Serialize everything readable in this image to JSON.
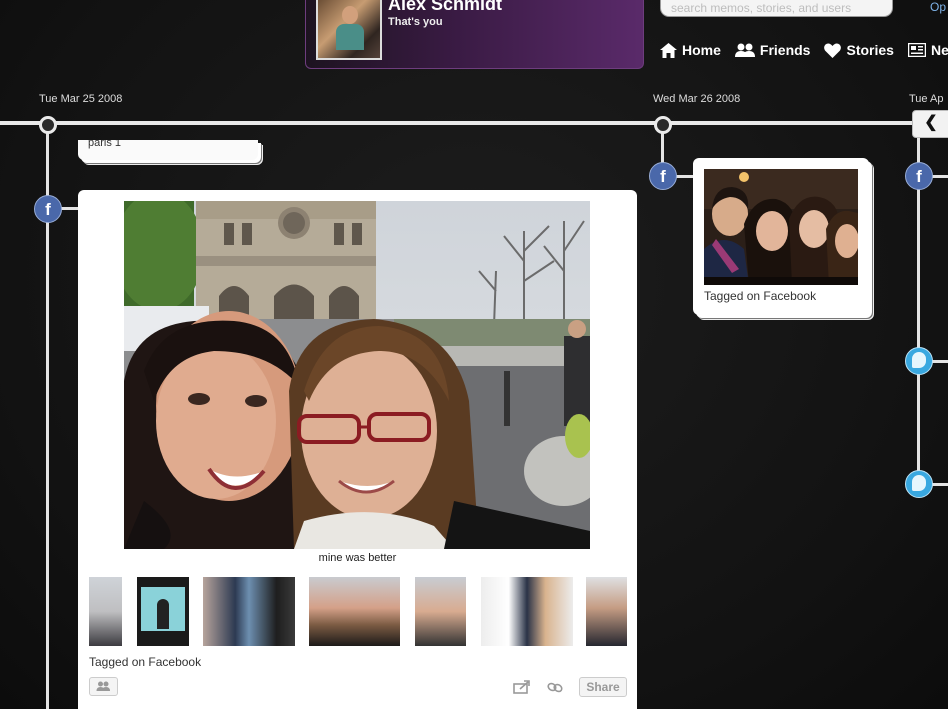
{
  "profile": {
    "name": "Alex Schmidt",
    "subtitle": "That's you"
  },
  "search": {
    "placeholder": "search memos, stories, and users"
  },
  "top_link": "Op",
  "nav": [
    {
      "label": "Home",
      "icon": "home-icon"
    },
    {
      "label": "Friends",
      "icon": "friends-icon"
    },
    {
      "label": "Stories",
      "icon": "heart-icon"
    },
    {
      "label": "New",
      "icon": "news-icon"
    }
  ],
  "timeline": {
    "dates": [
      "Tue Mar 25 2008",
      "Wed Mar 26 2008",
      "Tue Ap"
    ],
    "collapse_icon": "chevron-left-icon"
  },
  "stacked_card": {
    "text": "paris 1"
  },
  "main_card": {
    "caption": "mine was better",
    "tag": "Tagged on Facebook",
    "share_label": "Share",
    "thumbnail_count": 8
  },
  "side_card": {
    "tag": "Tagged on Facebook"
  },
  "badges": {
    "facebook_letter": "f",
    "facebook_color": "#4a68aa",
    "twitter_color": "#39a8e0"
  }
}
